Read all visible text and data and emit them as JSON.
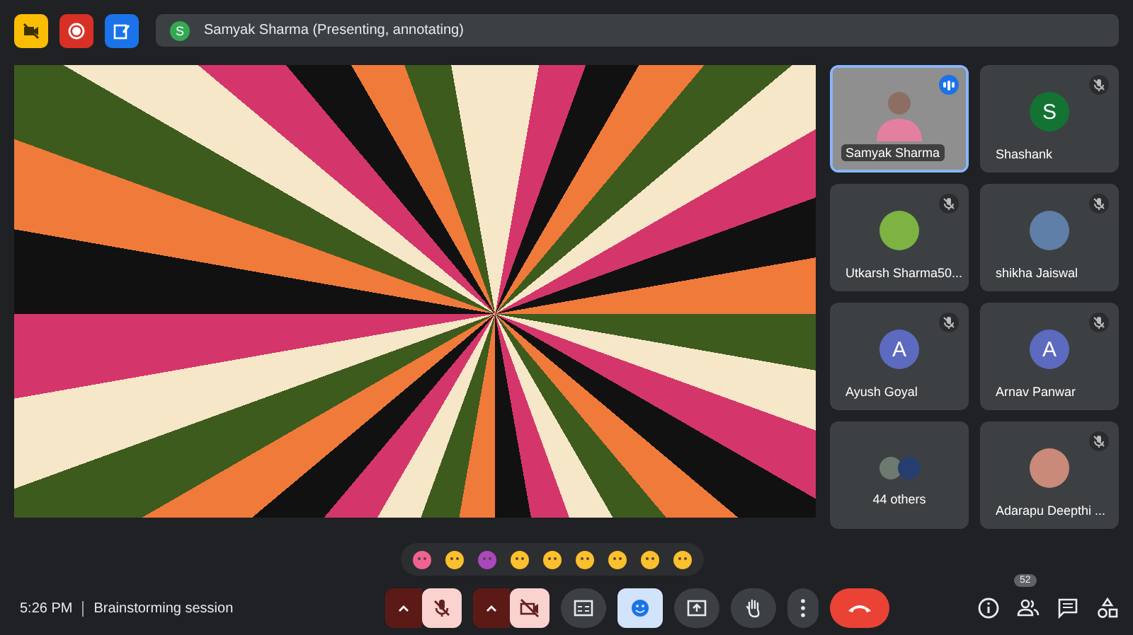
{
  "presenter": {
    "initial": "S",
    "label": "Samyak Sharma (Presenting, annotating)"
  },
  "tiles": [
    {
      "name": "Samyak Sharma",
      "kind": "video",
      "muted": false,
      "speaking": true
    },
    {
      "name": "Shashank",
      "kind": "initial",
      "initial": "S",
      "color": "#137333",
      "muted": true,
      "speaking": false
    },
    {
      "name": "Utkarsh Sharma50...",
      "kind": "avatar",
      "color": "#7cb342",
      "muted": true,
      "speaking": false
    },
    {
      "name": "shikha Jaiswal",
      "kind": "avatar",
      "color": "#5f7fa8",
      "muted": true,
      "speaking": false
    },
    {
      "name": "Ayush Goyal",
      "kind": "initial",
      "initial": "A",
      "color": "#5c6bc0",
      "muted": true,
      "speaking": false
    },
    {
      "name": "Arnav Panwar",
      "kind": "initial",
      "initial": "A",
      "color": "#5c6bc0",
      "muted": true,
      "speaking": false
    },
    {
      "name": "44 others",
      "kind": "others",
      "muted": false,
      "speaking": false
    },
    {
      "name": "Adarapu Deepthi ...",
      "kind": "avatar",
      "color": "#c98a7a",
      "muted": true,
      "speaking": false
    }
  ],
  "footer": {
    "time": "5:26 PM",
    "meeting": "Brainstorming session"
  },
  "controls": {
    "mic_on": false,
    "camera_on": false,
    "reactions_open": true
  },
  "people_count": "52"
}
